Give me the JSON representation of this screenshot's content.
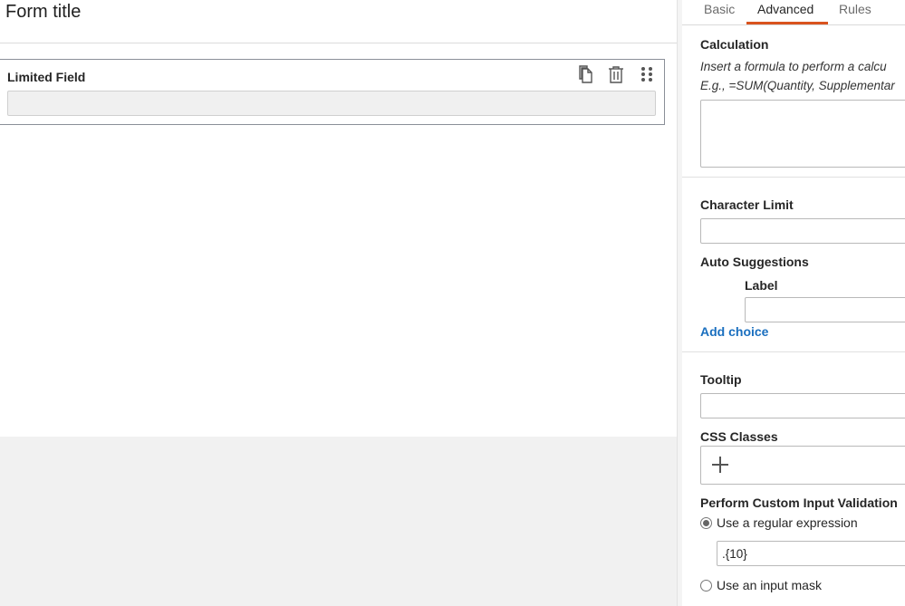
{
  "form": {
    "title": "Form title",
    "field": {
      "label": "Limited Field",
      "tools": [
        "copy-icon",
        "trash-icon",
        "drag-handle-icon"
      ]
    }
  },
  "panel": {
    "tabs": [
      {
        "label": "Basic",
        "active": false
      },
      {
        "label": "Advanced",
        "active": true
      },
      {
        "label": "Rules",
        "active": false
      }
    ],
    "calculation": {
      "label": "Calculation",
      "desc_line1": "Insert a formula to perform a calcu",
      "desc_line2": "E.g., =SUM(Quantity, Supplementar",
      "value": ""
    },
    "character_limit": {
      "label": "Character Limit",
      "value": ""
    },
    "auto_suggestions": {
      "label": "Auto Suggestions",
      "sub_label": "Label",
      "value": "",
      "add_choice": "Add choice"
    },
    "tooltip": {
      "label": "Tooltip",
      "value": ""
    },
    "css_classes": {
      "label": "CSS Classes"
    },
    "validation": {
      "label": "Perform Custom Input Validation",
      "option_regex": "Use a regular expression",
      "regex_value": ".{10}",
      "option_mask": "Use an input mask",
      "selected": "regex"
    }
  },
  "colors": {
    "accent_tab": "#d9531e",
    "link": "#1a6fbf"
  }
}
